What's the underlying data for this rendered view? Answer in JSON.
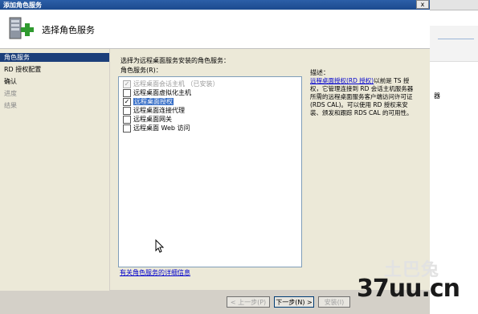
{
  "window": {
    "title": "添加角色服务",
    "close_label": "x"
  },
  "header": {
    "title": "选择角色服务",
    "icon": "server-add-icon"
  },
  "nav": {
    "items": [
      {
        "label": "角色服务",
        "state": "active"
      },
      {
        "label": "RD 授权配置",
        "state": "normal"
      },
      {
        "label": "确认",
        "state": "normal"
      },
      {
        "label": "进度",
        "state": "disabled"
      },
      {
        "label": "结果",
        "state": "disabled"
      }
    ]
  },
  "content": {
    "prompt": "选择为远程桌面服务安装的角色服务：",
    "list_label": "角色服务(R)：",
    "services": [
      {
        "label": "远程桌面会话主机  （已安装）",
        "checked": true,
        "disabled": true,
        "selected": false
      },
      {
        "label": "远程桌面虚拟化主机",
        "checked": false,
        "disabled": false,
        "selected": false
      },
      {
        "label": "远程桌面授权",
        "checked": true,
        "disabled": false,
        "selected": true
      },
      {
        "label": "远程桌面连接代理",
        "checked": false,
        "disabled": false,
        "selected": false
      },
      {
        "label": "远程桌面网关",
        "checked": false,
        "disabled": false,
        "selected": false
      },
      {
        "label": "远程桌面 Web 访问",
        "checked": false,
        "disabled": false,
        "selected": false
      }
    ],
    "desc_label": "描述：",
    "desc_link": "远程桌面授权(RD 授权)",
    "desc_text": "以前是 TS 授权，它管理连接到 RD 会话主机服务器所需的远程桌面服务客户端访问许可证(RDS CAL)。可以使用 RD 授权来安装、颁发和跟踪 RDS CAL 的可用性。",
    "more_link": "有关角色服务的详细信息"
  },
  "buttons": {
    "prev": "< 上一步(P)",
    "next": "下一步(N) >",
    "install": "安装(I)"
  },
  "background_window": {
    "fragment": "器"
  },
  "watermark": {
    "logo": "土巴兔",
    "text": "37uu.cn"
  },
  "colors": {
    "nav_active": "#1c3f7a",
    "selection": "#316ac5",
    "link": "#0000cc"
  }
}
